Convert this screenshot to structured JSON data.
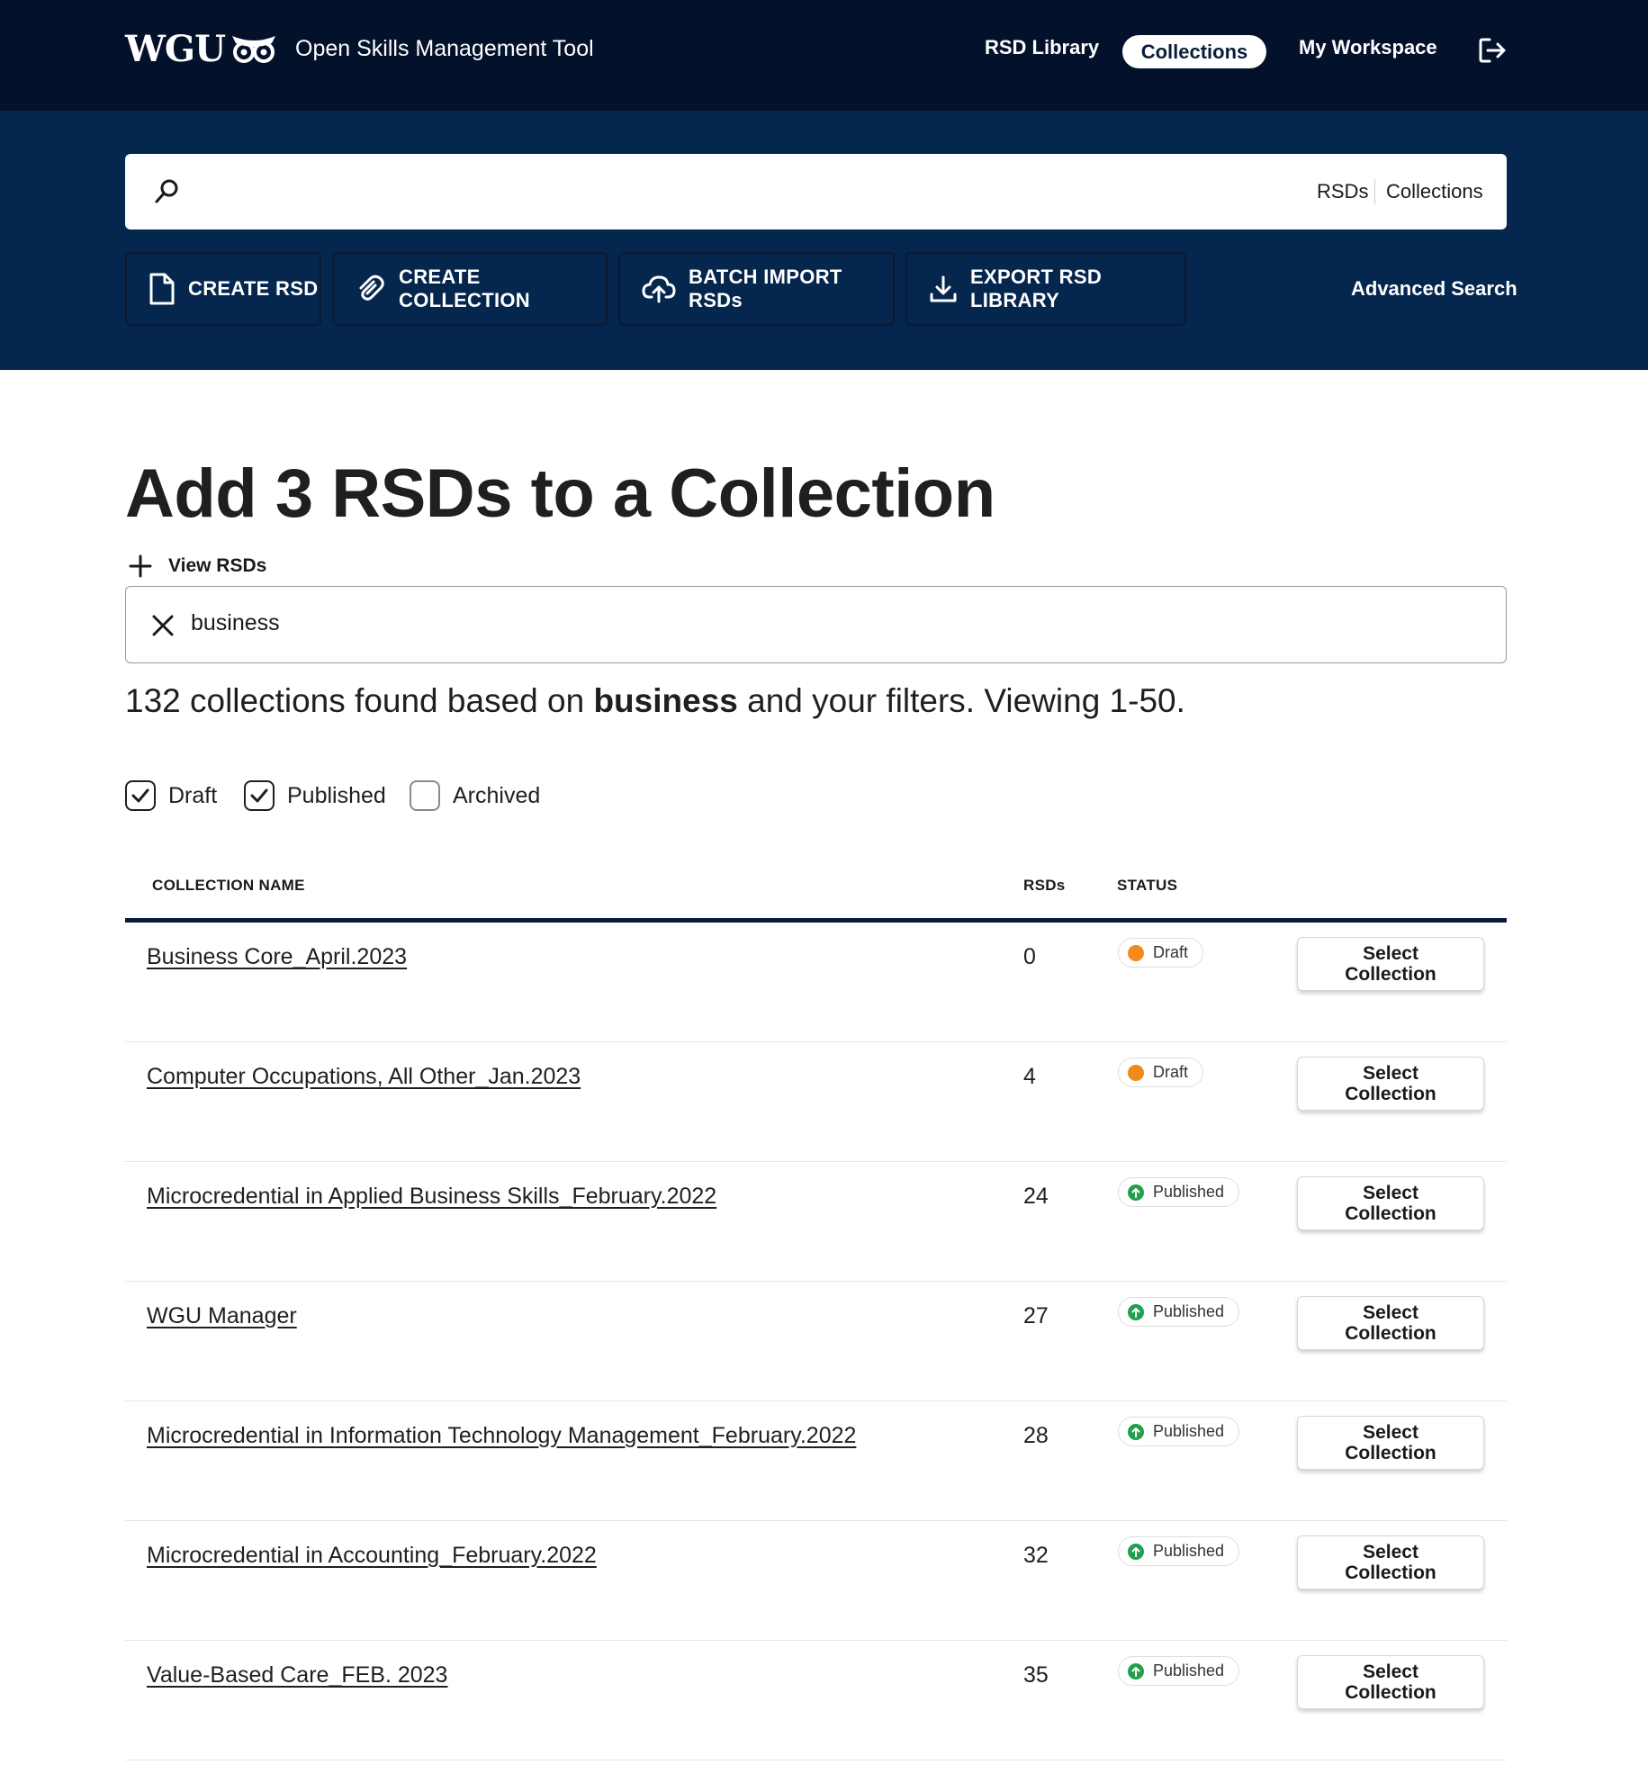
{
  "header": {
    "logo_text": "WGU",
    "app_title": "Open Skills Management Tool",
    "nav": {
      "rsd_library": "RSD Library",
      "collections": "Collections",
      "my_workspace": "My Workspace"
    },
    "logout_icon": "logout-icon"
  },
  "search": {
    "placeholder": "",
    "scope_rsds": "RSDs",
    "scope_collections": "Collections"
  },
  "actions": {
    "create_rsd": "CREATE RSD",
    "create_collection": "CREATE COLLECTION",
    "batch_import": "BATCH IMPORT RSDs",
    "export_library": "EXPORT RSD LIBRARY",
    "advanced_search": "Advanced Search"
  },
  "page": {
    "title": "Add 3 RSDs to a Collection",
    "view_rsds": "View RSDs",
    "filter_value": "business",
    "summary": {
      "prefix": "132 collections found based on",
      "term": "business",
      "suffix": "and your filters. Viewing 1-50."
    }
  },
  "filters": {
    "draft": {
      "label": "Draft",
      "checked": true
    },
    "published": {
      "label": "Published",
      "checked": true
    },
    "archived": {
      "label": "Archived",
      "checked": false
    }
  },
  "table": {
    "headers": {
      "name": "COLLECTION NAME",
      "rsds": "RSDs",
      "status": "STATUS"
    },
    "select_label": "Select Collection",
    "rows": [
      {
        "name": "Business Core_April.2023",
        "rsds": "0",
        "status": "Draft"
      },
      {
        "name": "Computer Occupations, All Other_Jan.2023",
        "rsds": "4",
        "status": "Draft"
      },
      {
        "name": "Microcredential in Applied Business Skills_February.2022",
        "rsds": "24",
        "status": "Published"
      },
      {
        "name": "WGU Manager",
        "rsds": "27",
        "status": "Published"
      },
      {
        "name": "Microcredential in Information Technology Management_February.2022",
        "rsds": "28",
        "status": "Published"
      },
      {
        "name": "Microcredential in Accounting_February.2022",
        "rsds": "32",
        "status": "Published"
      },
      {
        "name": "Value-Based Care_FEB. 2023",
        "rsds": "35",
        "status": "Published"
      }
    ]
  },
  "colors": {
    "nav_bg": "#03112b",
    "band_bg": "#05264d",
    "draft": "#f28a1e",
    "published": "#22a04b"
  }
}
